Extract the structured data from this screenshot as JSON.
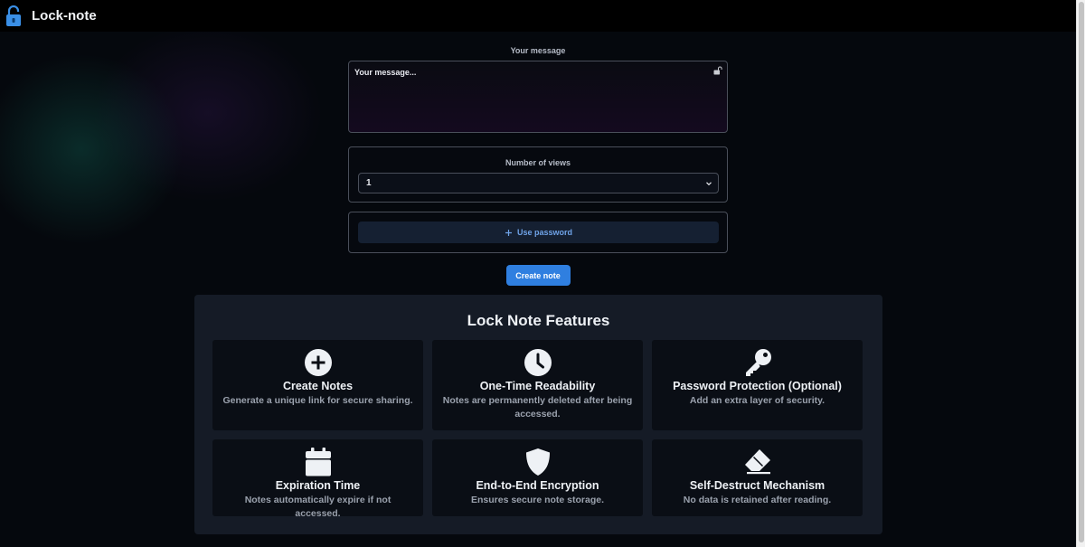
{
  "header": {
    "brand": "Lock-note",
    "logo_icon": "padlock-icon"
  },
  "form": {
    "message_label": "Your message",
    "message_placeholder": "Your message...",
    "message_value": "",
    "views_label": "Number of views",
    "views_selected": "1",
    "password_button": "Use password",
    "create_button": "Create note"
  },
  "features": {
    "title": "Lock Note Features",
    "items": [
      {
        "icon": "plus-circle-icon",
        "title": "Create Notes",
        "desc": "Generate a unique link for secure sharing."
      },
      {
        "icon": "clock-icon",
        "title": "One-Time Readability",
        "desc": "Notes are permanently deleted after being accessed."
      },
      {
        "icon": "key-icon",
        "title": "Password Protection (Optional)",
        "desc": "Add an extra layer of security."
      },
      {
        "icon": "calendar-icon",
        "title": "Expiration Time",
        "desc": "Notes automatically expire if not accessed."
      },
      {
        "icon": "shield-icon",
        "title": "End-to-End Encryption",
        "desc": "Ensures secure note storage."
      },
      {
        "icon": "eraser-icon",
        "title": "Self-Destruct Mechanism",
        "desc": "No data is retained after reading."
      }
    ]
  },
  "colors": {
    "accent": "#2f7fe0",
    "password_text": "#6fa3e8",
    "panel_bg": "#151b26",
    "card_bg": "#0a0e15",
    "logo_blue": "#3a8fe6"
  }
}
